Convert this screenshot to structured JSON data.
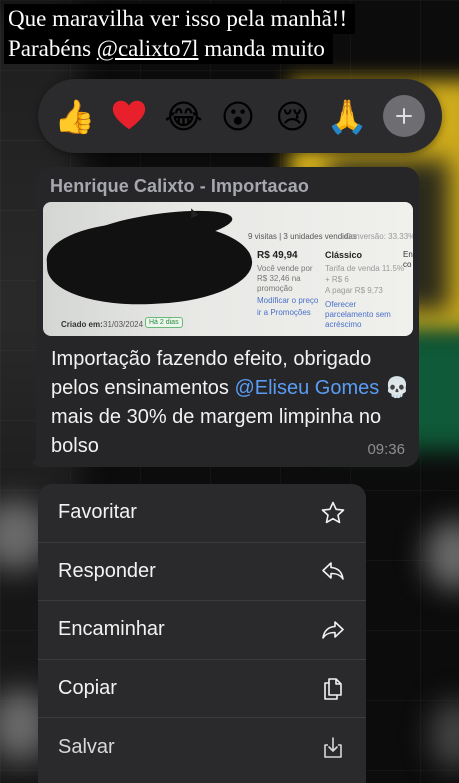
{
  "caption": {
    "line1": "Que maravilha ver isso pela manhã!!",
    "line2_prefix": "Parabéns ",
    "line2_mention": "@calixto7l",
    "line2_suffix": " manda muito"
  },
  "reactions": {
    "items": [
      {
        "name": "thumbs-up",
        "glyph": "👍"
      },
      {
        "name": "red-heart",
        "glyph": "❤️"
      },
      {
        "name": "laughing-crying",
        "glyph": "😂"
      },
      {
        "name": "surprised",
        "glyph": "😮"
      },
      {
        "name": "crying",
        "glyph": "😢"
      },
      {
        "name": "folded-hands",
        "glyph": "🙏"
      }
    ],
    "add_icon": "plus-icon"
  },
  "message": {
    "sender": "Henrique Calixto - Importacao",
    "image": {
      "visits": "9 visitas | 3 unidades vendidas",
      "conversion": "Conversão: 33.33%",
      "price": "R$ 49,94",
      "sells_for_1": "Você vende por",
      "sells_for_2": "R$ 32,46 na",
      "sells_for_3": "promoção",
      "modify_price": "Modificar o preço",
      "go_promotions": "ir a Promoções",
      "classic": "Clássico",
      "sale_fee": "Tarifa de venda 11.5%",
      "plus": "+ R$ 6",
      "to_pay": "A pagar R$ 9,73",
      "offer_1": "Oferecer",
      "offer_2": "parcelamento sem",
      "offer_3": "acréscimo",
      "created_label": "Criado em:",
      "created_date": "31/03/2024",
      "age_badge": "Há 2 dias",
      "env": "En",
      "con": "co"
    },
    "text_part1": "Importação fazendo efeito, obrigado pelos ensinamentos ",
    "mention": "@Eliseu Gomes",
    "emoji": "💀",
    "text_part2": " mais de 30% de margem limpinha no bolso",
    "time": "09:36"
  },
  "menu": {
    "items": [
      {
        "label": "Favoritar",
        "icon": "star-icon"
      },
      {
        "label": "Responder",
        "icon": "reply-icon"
      },
      {
        "label": "Encaminhar",
        "icon": "forward-icon"
      },
      {
        "label": "Copiar",
        "icon": "copy-icon"
      },
      {
        "label": "Salvar",
        "icon": "save-icon"
      }
    ]
  },
  "colors": {
    "bubble": "#262628",
    "menu": "#2a2a2c",
    "mention": "#5a9cf5",
    "sender": "#a7a7b0"
  }
}
